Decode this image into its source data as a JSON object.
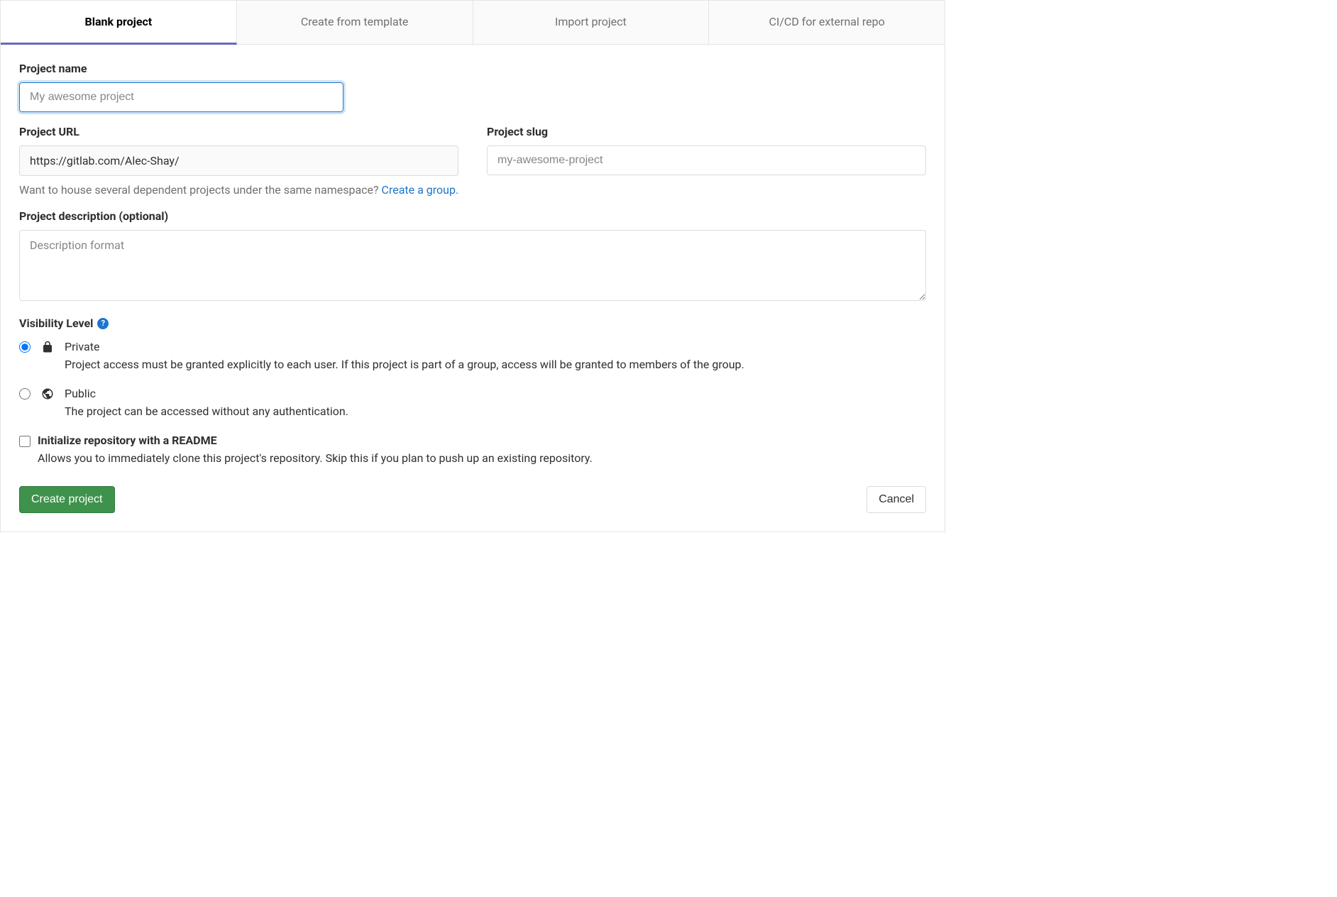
{
  "tabs": {
    "blank": "Blank project",
    "template": "Create from template",
    "import": "Import project",
    "cicd": "CI/CD for external repo"
  },
  "form": {
    "name_label": "Project name",
    "name_placeholder": "My awesome project",
    "url_label": "Project URL",
    "url_value": "https://gitlab.com/Alec-Shay/",
    "slug_label": "Project slug",
    "slug_placeholder": "my-awesome-project",
    "namespace_help": "Want to house several dependent projects under the same namespace? ",
    "namespace_link": "Create a group.",
    "description_label": "Project description (optional)",
    "description_placeholder": "Description format",
    "visibility_label": "Visibility Level",
    "visibility": {
      "private": {
        "title": "Private",
        "desc": "Project access must be granted explicitly to each user. If this project is part of a group, access will be granted to members of the group."
      },
      "public": {
        "title": "Public",
        "desc": "The project can be accessed without any authentication."
      }
    },
    "readme": {
      "title": "Initialize repository with a README",
      "desc": "Allows you to immediately clone this project's repository. Skip this if you plan to push up an existing repository."
    }
  },
  "actions": {
    "create": "Create project",
    "cancel": "Cancel"
  }
}
